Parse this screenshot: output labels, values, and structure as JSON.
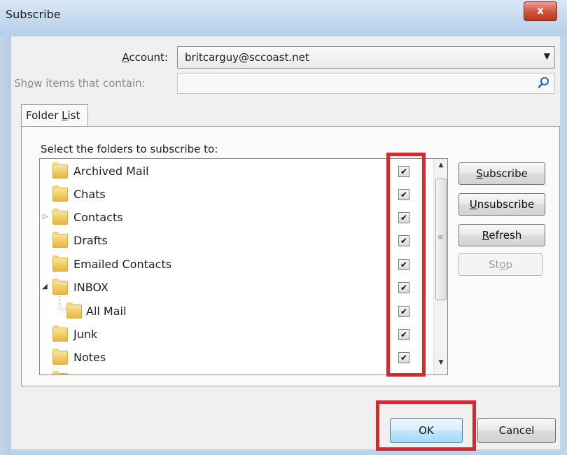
{
  "window": {
    "title": "Subscribe",
    "close_glyph": "x"
  },
  "account": {
    "label": "Account:",
    "value": "britcarguy@sccoast.net"
  },
  "filter": {
    "label": "Show items that contain:",
    "value": ""
  },
  "tab": {
    "label": "Folder List"
  },
  "panel": {
    "caption": "Select the folders to subscribe to:"
  },
  "folders": [
    {
      "name": "Archived Mail",
      "checked": "✔"
    },
    {
      "name": "Chats",
      "checked": "✔"
    },
    {
      "name": "Contacts",
      "checked": "✔"
    },
    {
      "name": "Drafts",
      "checked": "✔"
    },
    {
      "name": "Emailed Contacts",
      "checked": "✔"
    },
    {
      "name": "INBOX",
      "checked": "✔"
    },
    {
      "name": "All Mail",
      "checked": "✔"
    },
    {
      "name": "Junk",
      "checked": "✔"
    },
    {
      "name": "Notes",
      "checked": "✔"
    }
  ],
  "buttons": {
    "subscribe": "Subscribe",
    "unsubscribe": "Unsubscribe",
    "refresh": "Refresh",
    "stop": "Stop",
    "ok": "OK",
    "cancel": "Cancel"
  },
  "colors": {
    "highlight": "#d7282f",
    "folder": "#f0c75a"
  }
}
